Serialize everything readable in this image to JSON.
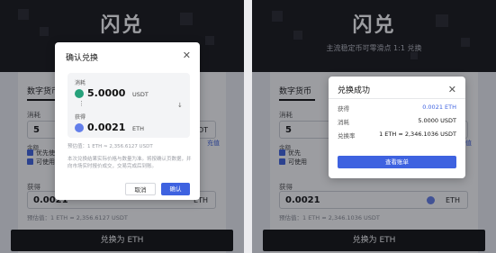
{
  "left": {
    "page": {
      "title": "闪兑",
      "subtitle": "主流稳定币可零滑点 1:1 兑换",
      "tab": "数字货币",
      "pay_label": "消耗",
      "pay_value": "5",
      "pay_unit": "DT",
      "balance_label": "余额",
      "check1": "优先使用",
      "check2": "可使用",
      "recharge_link": "充值",
      "receive_label": "获得",
      "receive_value": "0.0021",
      "receive_unit": "ETH",
      "rate_text": "预估值：1 ETH ≈ 2,356.6127 USDT",
      "exchange_button": "兑换为 ETH"
    },
    "modal": {
      "title": "确认兑换",
      "pay_label": "消耗",
      "pay_amount": "5.0000",
      "pay_unit": "USDT",
      "receive_label": "获得",
      "receive_amount": "0.0021",
      "receive_unit": "ETH",
      "rate_text": "预估值：1 ETH ≈ 2,356.6127 USDT",
      "note": "本次兑换结果实际价格与数量为准。将按确认页数据，并向市场实时报价成交，交易完成后到账。",
      "cancel": "取消",
      "confirm": "确认"
    }
  },
  "right": {
    "page": {
      "title": "闪兑",
      "subtitle": "主流稳定币可零滑点 1:1 兑换",
      "tab": "数字货币",
      "pay_label": "消耗",
      "pay_value": "5",
      "pay_unit": "DT",
      "balance_label": "余额",
      "check1": "优先",
      "check2": "可使用",
      "recharge_link": "充值",
      "receive_label": "获得",
      "receive_value": "0.0021",
      "receive_unit": "ETH",
      "rate_text": "预估值：1 ETH ≈ 2,346.1036 USDT",
      "exchange_button": "兑换为 ETH"
    },
    "modal": {
      "title": "兑换成功",
      "rows": [
        {
          "label": "获得",
          "value": "0.0021 ETH"
        },
        {
          "label": "消耗",
          "value": "5.0000 USDT"
        },
        {
          "label": "兑换率",
          "value": "1 ETH ≈ 2,346.1036 USDT"
        }
      ],
      "view_button": "查看账单"
    }
  },
  "colors": {
    "accent": "#3e62e0",
    "usdt": "#26a17b",
    "eth": "#627eea",
    "hero": "#151518"
  }
}
